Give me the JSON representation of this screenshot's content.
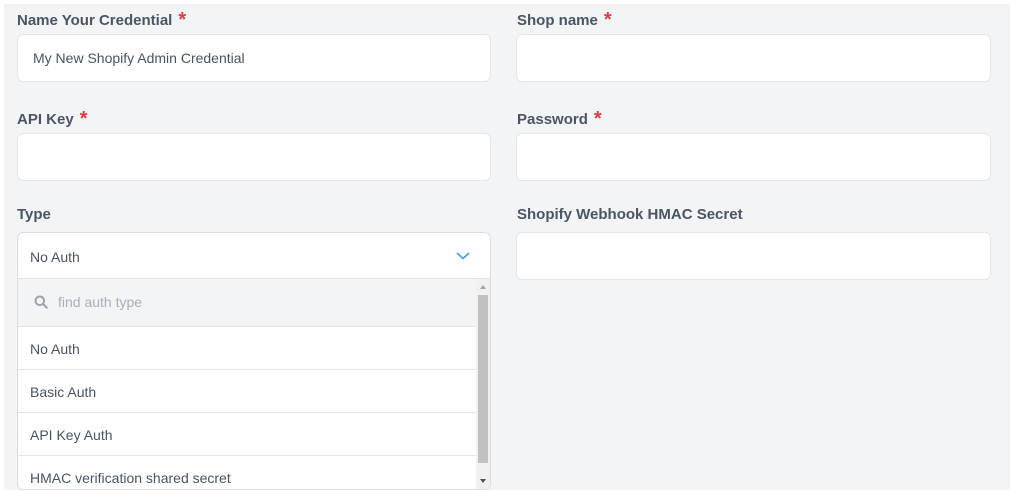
{
  "form": {
    "credential_name": {
      "label": "Name Your Credential",
      "required_mark": "*",
      "value": "My New Shopify Admin Credential"
    },
    "shop_name": {
      "label": "Shop name",
      "required_mark": "*",
      "value": ""
    },
    "api_key": {
      "label": "API Key",
      "required_mark": "*",
      "value": ""
    },
    "password": {
      "label": "Password",
      "required_mark": "*",
      "value": ""
    },
    "type": {
      "label": "Type",
      "selected": "No Auth",
      "search_placeholder": "find auth type",
      "options": [
        "No Auth",
        "Basic Auth",
        "API Key Auth",
        "HMAC verification shared secret"
      ]
    },
    "webhook_secret": {
      "label": "Shopify Webhook HMAC Secret",
      "value": ""
    }
  },
  "colors": {
    "background": "#f3f4f6",
    "label": "#4a5565",
    "required": "#e53945",
    "accent": "#4aa3d6"
  },
  "icons": {
    "dropdown": "chevron-down-icon",
    "search": "search-icon"
  }
}
